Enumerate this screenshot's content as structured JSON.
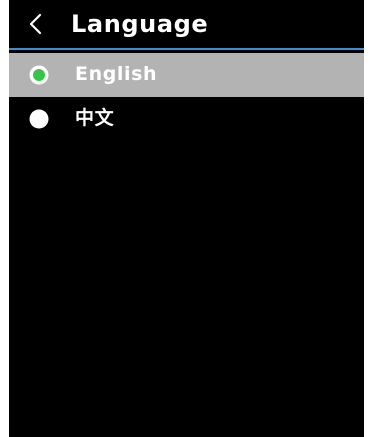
{
  "header": {
    "back_icon": "chevron-left-icon",
    "title": "Language"
  },
  "languages": [
    {
      "label": "English",
      "selected": true
    },
    {
      "label": "中文",
      "selected": false
    }
  ],
  "colors": {
    "selected_row_bg": "#b3b3b3",
    "selected_radio": "#36c54a",
    "unselected_radio": "#ffffff",
    "header_divider": "#3a8fd6",
    "screen_bg": "#000000"
  }
}
